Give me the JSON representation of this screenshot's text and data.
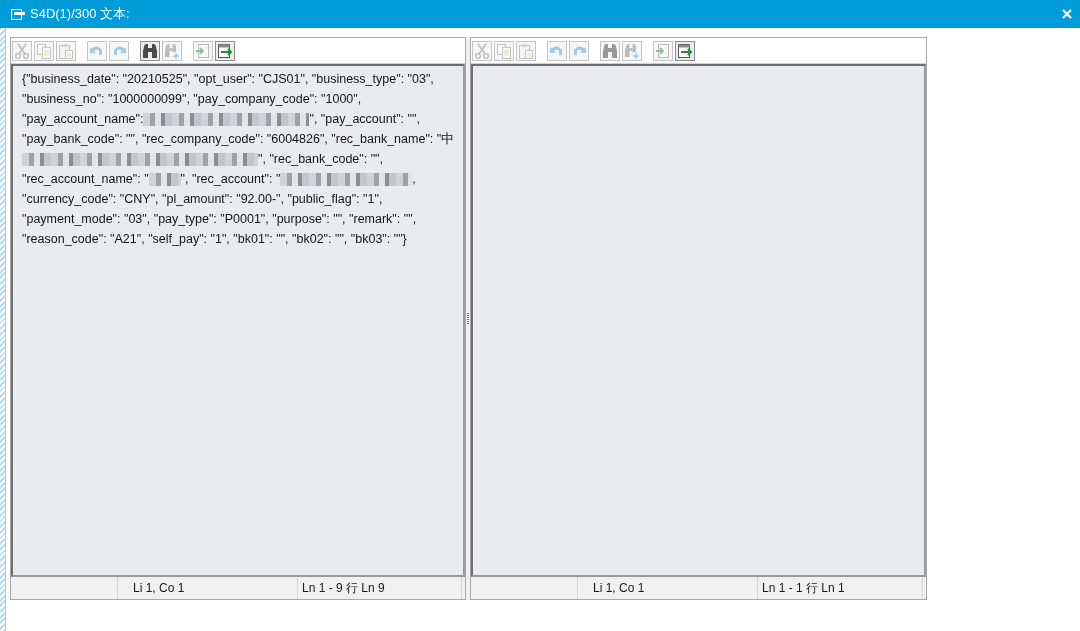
{
  "window": {
    "title": "S4D(1)/300 文本:"
  },
  "editors": [
    {
      "toolbar": [
        {
          "kind": "cut",
          "disabled": true
        },
        {
          "kind": "copy",
          "disabled": true
        },
        {
          "kind": "paste",
          "disabled": true
        },
        {
          "kind": "undo",
          "disabled": true
        },
        {
          "kind": "redo",
          "disabled": true
        },
        {
          "kind": "find",
          "disabled": false
        },
        {
          "kind": "find_next",
          "disabled": true
        },
        {
          "kind": "import",
          "disabled": true
        },
        {
          "kind": "export",
          "disabled": false
        }
      ],
      "lines": [
        [
          {
            "kind": "text",
            "text": "{\"business_date\": \"20210525\", \"opt_user\": \"CJS01\", \"business_type\": \"03\","
          }
        ],
        [
          {
            "kind": "text",
            "text": "\"business_no\": \"1000000099\", \"pay_company_code\": \"1000\","
          }
        ],
        [
          {
            "kind": "text",
            "text": "\"pay_account_name\":"
          },
          {
            "kind": "blur_long"
          },
          {
            "kind": "text",
            "text": "\", \"pay_account\": \"\","
          }
        ],
        [
          {
            "kind": "text",
            "text": "\"pay_bank_code\": \"\", \"rec_company_code\": \"6004826\", \"rec_bank_name\": \"中"
          }
        ],
        [
          {
            "kind": "blur_wide"
          },
          {
            "kind": "text",
            "text": "\", \"rec_bank_code\": \"\","
          }
        ],
        [
          {
            "kind": "text",
            "text": "\"rec_account_name\": \""
          },
          {
            "kind": "blur_short"
          },
          {
            "kind": "text",
            "text": "\", \"rec_account\": \""
          },
          {
            "kind": "blur_medium"
          },
          {
            "kind": "text",
            "text": ","
          }
        ],
        [
          {
            "kind": "text",
            "text": "\"currency_code\": \"CNY\", \"pl_amount\": \"92.00-\", \"public_flag\": \"1\","
          }
        ],
        [
          {
            "kind": "text",
            "text": "\"payment_mode\": \"03\", \"pay_type\": \"P0001\", \"purpose\": \"\", \"remark\": \"\","
          }
        ],
        [
          {
            "kind": "text",
            "text": "\"reason_code\": \"A21\", \"self_pay\": \"1\", \"bk01\": \"\", \"bk02\": \"\", \"bk03\": \"\"}"
          }
        ]
      ],
      "status": {
        "cursor": "Li 1, Co 1",
        "range": "Ln 1 - 9 行 Ln 9"
      }
    },
    {
      "toolbar": [
        {
          "kind": "cut",
          "disabled": true
        },
        {
          "kind": "copy",
          "disabled": true
        },
        {
          "kind": "paste",
          "disabled": true
        },
        {
          "kind": "undo",
          "disabled": true
        },
        {
          "kind": "redo",
          "disabled": true
        },
        {
          "kind": "find",
          "disabled": true
        },
        {
          "kind": "find_next",
          "disabled": true
        },
        {
          "kind": "import",
          "disabled": true
        },
        {
          "kind": "export",
          "disabled": false
        }
      ],
      "status": {
        "cursor": "Li 1, Co 1",
        "range": "Ln 1 - 1 行 Ln 1"
      }
    }
  ]
}
